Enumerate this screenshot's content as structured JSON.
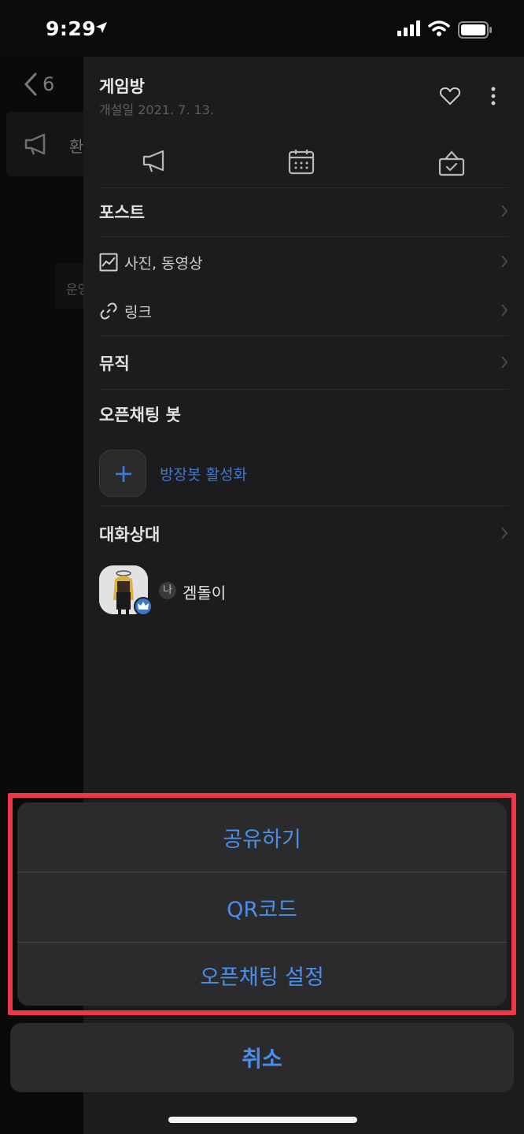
{
  "status_bar": {
    "time": "9:29"
  },
  "background": {
    "back_count": "6",
    "notice_text": "환",
    "bubble_text": "운영"
  },
  "drawer": {
    "title": "게임방",
    "created": "개설일 2021. 7. 13.",
    "menu": {
      "post": "포스트",
      "photos_videos": "사진, 동영상",
      "links": "링크",
      "music": "뮤직",
      "openchat_bot": "오픈채팅 봇",
      "bot_activate": "방장봇 활성화",
      "participants": "대화상대"
    },
    "member": {
      "me_badge": "나",
      "name": "겜돌이"
    }
  },
  "action_sheet": {
    "items": [
      "공유하기",
      "QR코드",
      "오픈채팅 설정"
    ],
    "cancel": "취소"
  },
  "colors": {
    "accent": "#4a8eea",
    "highlight": "#f2364a"
  }
}
